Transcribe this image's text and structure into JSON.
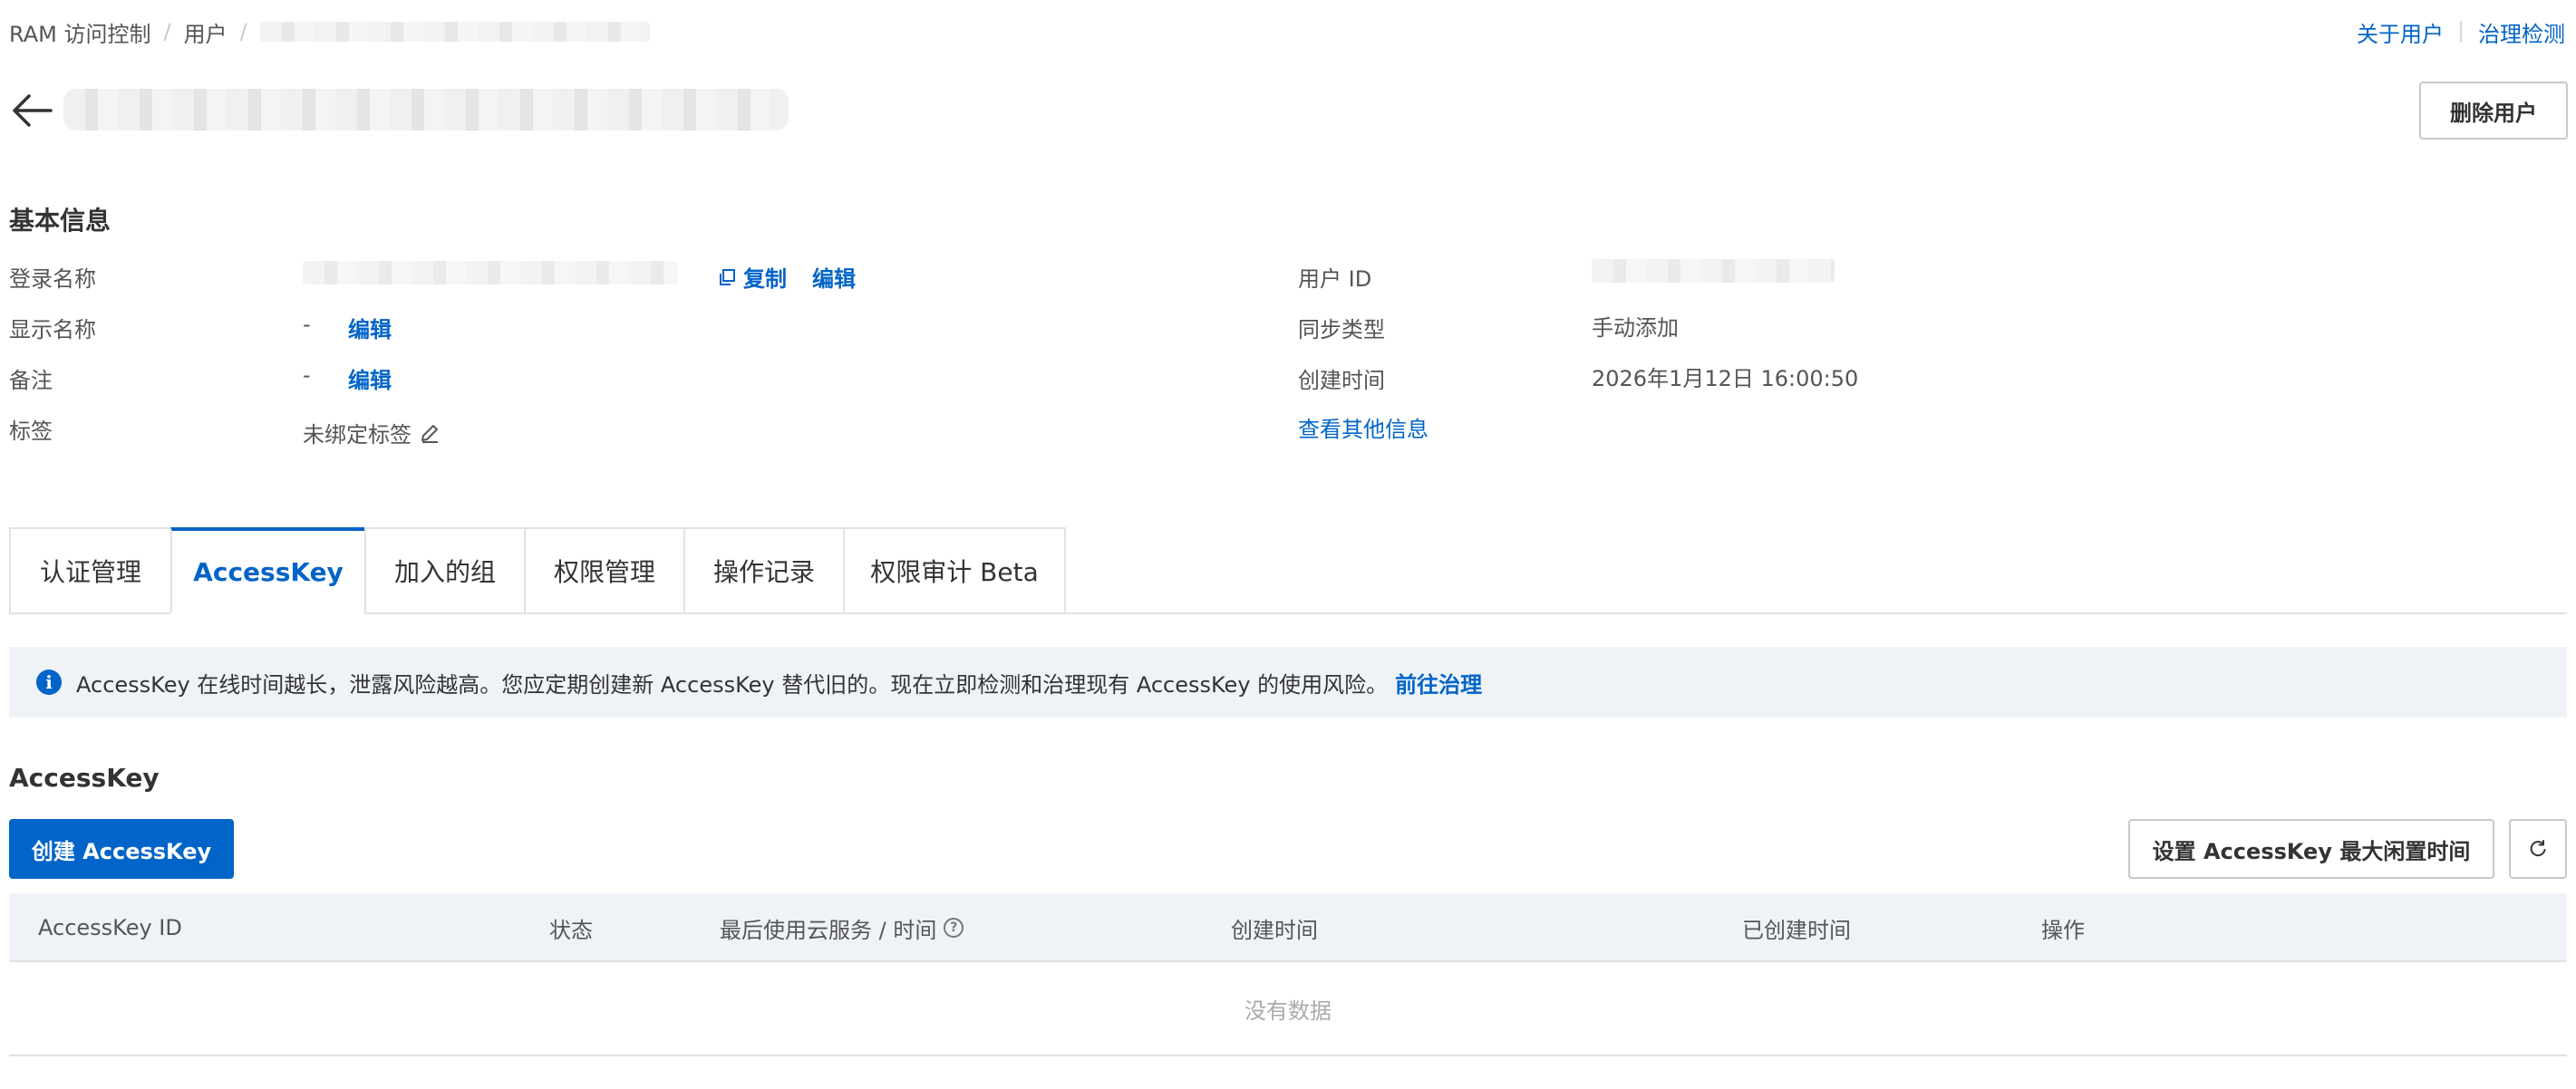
{
  "breadcrumb": {
    "items": [
      "RAM 访问控制",
      "用户"
    ]
  },
  "top_links": {
    "about_users": "关于用户",
    "governance_check": "治理检测"
  },
  "header": {
    "delete_user": "删除用户"
  },
  "basic_info": {
    "title": "基本信息",
    "login_name_label": "登录名称",
    "copy": "复制",
    "edit": "编辑",
    "display_name_label": "显示名称",
    "display_name_value": "-",
    "remark_label": "备注",
    "remark_value": "-",
    "tags_label": "标签",
    "tags_value": "未绑定标签",
    "user_id_label": "用户 ID",
    "sync_type_label": "同步类型",
    "sync_type_value": "手动添加",
    "created_time_label": "创建时间",
    "created_time_value": "2026年1月12日 16:00:50",
    "more_info": "查看其他信息"
  },
  "tabs": [
    {
      "label": "认证管理",
      "active": false
    },
    {
      "label": "AccessKey",
      "active": true
    },
    {
      "label": "加入的组",
      "active": false
    },
    {
      "label": "权限管理",
      "active": false
    },
    {
      "label": "操作记录",
      "active": false
    },
    {
      "label": "权限审计 Beta",
      "active": false
    }
  ],
  "notice": {
    "text": "AccessKey 在线时间越长，泄露风险越高。您应定期创建新 AccessKey 替代旧的。现在立即检测和治理现有 AccessKey 的使用风险。",
    "link": "前往治理"
  },
  "accesskey": {
    "title": "AccessKey",
    "create_button": "创建 AccessKey",
    "max_idle_button": "设置 AccessKey 最大闲置时间",
    "table": {
      "columns": [
        "AccessKey ID",
        "状态",
        "最后使用云服务 / 时间",
        "创建时间",
        "已创建时间",
        "操作"
      ],
      "empty_text": "没有数据"
    }
  },
  "colors": {
    "accent": "#0064c8",
    "notice_bg": "#eff3f8"
  }
}
